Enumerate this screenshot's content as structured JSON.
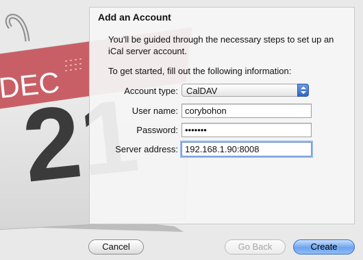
{
  "calendar": {
    "month": "DEC",
    "day": "21"
  },
  "dialog": {
    "title": "Add an Account",
    "intro": "You'll be guided through the necessary steps to set up an iCal server account.",
    "prompt": "To get started, fill out the following information:",
    "fields": {
      "account_type": {
        "label": "Account type:",
        "value": "CalDAV"
      },
      "user_name": {
        "label": "User name:",
        "value": "corybohon"
      },
      "password": {
        "label": "Password:",
        "value": "•••••••"
      },
      "server_address": {
        "label": "Server address:",
        "value": "192.168.1.90:8008"
      }
    }
  },
  "buttons": {
    "cancel": "Cancel",
    "go_back": "Go Back",
    "create": "Create"
  },
  "colors": {
    "calendar_red": "#c95f66",
    "accent_blue": "#6da4ee",
    "focus_ring": "#93b8e8"
  }
}
